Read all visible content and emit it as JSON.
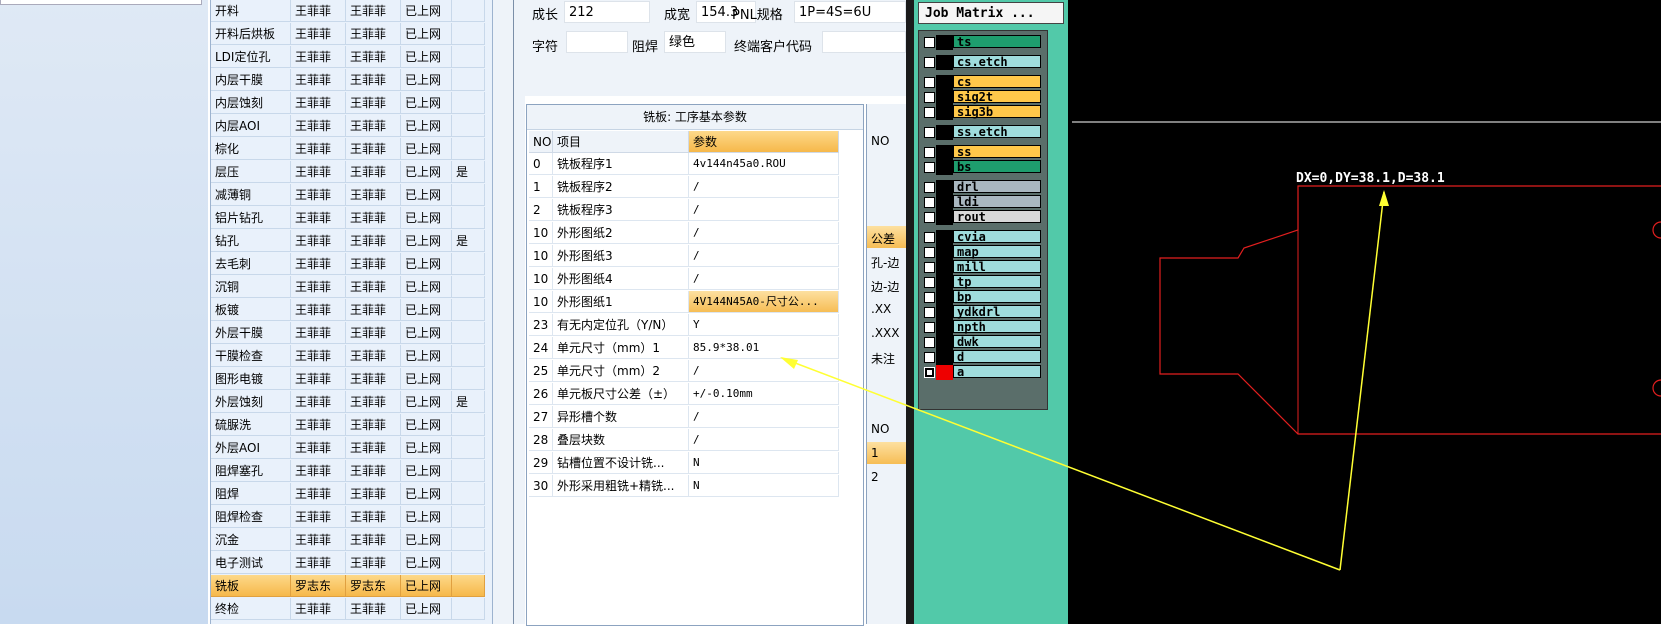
{
  "process_rows": [
    [
      "开料",
      "王菲菲",
      "王菲菲",
      "已上网",
      ""
    ],
    [
      "开料后烘板",
      "王菲菲",
      "王菲菲",
      "已上网",
      ""
    ],
    [
      "LDI定位孔",
      "王菲菲",
      "王菲菲",
      "已上网",
      ""
    ],
    [
      "内层干膜",
      "王菲菲",
      "王菲菲",
      "已上网",
      ""
    ],
    [
      "内层蚀刻",
      "王菲菲",
      "王菲菲",
      "已上网",
      ""
    ],
    [
      "内层AOI",
      "王菲菲",
      "王菲菲",
      "已上网",
      ""
    ],
    [
      "棕化",
      "王菲菲",
      "王菲菲",
      "已上网",
      ""
    ],
    [
      "层压",
      "王菲菲",
      "王菲菲",
      "已上网",
      "是"
    ],
    [
      "减薄铜",
      "王菲菲",
      "王菲菲",
      "已上网",
      ""
    ],
    [
      "铝片钻孔",
      "王菲菲",
      "王菲菲",
      "已上网",
      ""
    ],
    [
      "钻孔",
      "王菲菲",
      "王菲菲",
      "已上网",
      "是"
    ],
    [
      "去毛刺",
      "王菲菲",
      "王菲菲",
      "已上网",
      ""
    ],
    [
      "沉铜",
      "王菲菲",
      "王菲菲",
      "已上网",
      ""
    ],
    [
      "板镀",
      "王菲菲",
      "王菲菲",
      "已上网",
      ""
    ],
    [
      "外层干膜",
      "王菲菲",
      "王菲菲",
      "已上网",
      ""
    ],
    [
      "干膜检查",
      "王菲菲",
      "王菲菲",
      "已上网",
      ""
    ],
    [
      "图形电镀",
      "王菲菲",
      "王菲菲",
      "已上网",
      ""
    ],
    [
      "外层蚀刻",
      "王菲菲",
      "王菲菲",
      "已上网",
      "是"
    ],
    [
      "硫脲洗",
      "王菲菲",
      "王菲菲",
      "已上网",
      ""
    ],
    [
      "外层AOI",
      "王菲菲",
      "王菲菲",
      "已上网",
      ""
    ],
    [
      "阻焊塞孔",
      "王菲菲",
      "王菲菲",
      "已上网",
      ""
    ],
    [
      "阻焊",
      "王菲菲",
      "王菲菲",
      "已上网",
      ""
    ],
    [
      "阻焊检查",
      "王菲菲",
      "王菲菲",
      "已上网",
      ""
    ],
    [
      "沉金",
      "王菲菲",
      "王菲菲",
      "已上网",
      ""
    ],
    [
      "电子测试",
      "王菲菲",
      "王菲菲",
      "已上网",
      ""
    ],
    [
      "铣板",
      "罗志东",
      "罗志东",
      "已上网",
      ""
    ],
    [
      "终检",
      "王菲菲",
      "王菲菲",
      "已上网",
      ""
    ]
  ],
  "form": {
    "len_label": "成长",
    "len_value": "212",
    "width_label": "成宽",
    "width_value": "154.3",
    "pnl_label": "PNL规格",
    "pnl_value": "1P=4S=6U",
    "char_label": "字符",
    "char_value": "",
    "mask_label": "阻焊",
    "mask_value": "绿色",
    "cust_label": "终端客户代码",
    "cust_value": ""
  },
  "params": {
    "title": "铣板: 工序基本参数",
    "col_no": "NO",
    "col_item": "项目",
    "col_param": "参数",
    "rows": [
      [
        "0",
        "铣板程序1",
        "4v144n45a0.ROU"
      ],
      [
        "1",
        "铣板程序2",
        "/"
      ],
      [
        "2",
        "铣板程序3",
        "/"
      ],
      [
        "10",
        "外形图纸2",
        "/"
      ],
      [
        "10",
        "外形图纸3",
        "/"
      ],
      [
        "10",
        "外形图纸4",
        "/"
      ],
      [
        "10",
        "外形图纸1",
        "4V144N45A0-尺寸公..."
      ],
      [
        "23",
        "有无内定位孔（Y/N）",
        "Y"
      ],
      [
        "24",
        "单元尺寸（mm）1",
        "85.9*38.01"
      ],
      [
        "25",
        "单元尺寸（mm）2",
        "/"
      ],
      [
        "26",
        "单元板尺寸公差（±）",
        "+/-0.10mm"
      ],
      [
        "27",
        "异形槽个数",
        "/"
      ],
      [
        "28",
        "叠层块数",
        "/"
      ],
      [
        "29",
        "钻槽位置不设计铣...",
        "N"
      ],
      [
        "30",
        "外形采用粗铣+精铣...",
        "N"
      ]
    ]
  },
  "side": {
    "no1": "NO",
    "gc": "公差",
    "kong": "孔-边",
    "bian": "边-边",
    "xx": ".XX",
    "xxx": ".XXX",
    "wz": "未注",
    "no2": "NO",
    "r1": "1",
    "r2": "2"
  },
  "matrix": {
    "title": "Job Matrix ...",
    "layers": [
      {
        "name": "ts",
        "color": "#1e9e6e",
        "icon": "checkbox-icon"
      },
      {
        "name": "cs.etch",
        "color": "#9fdcdc",
        "icon": "checkbox-icon"
      },
      {
        "name": "cs",
        "color": "#ffc84a",
        "icon": "checkbox-icon"
      },
      {
        "name": "sig2t",
        "color": "#ffc84a",
        "icon": "checkbox-icon"
      },
      {
        "name": "sig3b",
        "color": "#ffc84a",
        "icon": "checkbox-icon"
      },
      {
        "name": "ss.etch",
        "color": "#9fdcdc",
        "icon": "checkbox-icon"
      },
      {
        "name": "ss",
        "color": "#ffc84a",
        "icon": "checkbox-icon"
      },
      {
        "name": "bs",
        "color": "#1e9e6e",
        "icon": "checkbox-icon"
      },
      {
        "name": "drl",
        "color": "#a9b7c0",
        "icon": "checkbox-icon"
      },
      {
        "name": "ldi",
        "color": "#a9b7c0",
        "icon": "checkbox-icon"
      },
      {
        "name": "rout",
        "color": "#d8d8d8",
        "icon": "checkbox-icon"
      },
      {
        "name": "cvia",
        "color": "#9fdcdc",
        "icon": "checkbox-icon"
      },
      {
        "name": "map",
        "color": "#9fdcdc",
        "icon": "checkbox-icon"
      },
      {
        "name": "mill",
        "color": "#9fdcdc",
        "icon": "checkbox-icon"
      },
      {
        "name": "tp",
        "color": "#9fdcdc",
        "icon": "checkbox-icon"
      },
      {
        "name": "bp",
        "color": "#9fdcdc",
        "icon": "checkbox-icon"
      },
      {
        "name": "ydkdrl",
        "color": "#9fdcdc",
        "icon": "checkbox-icon"
      },
      {
        "name": "npth",
        "color": "#9fdcdc",
        "icon": "checkbox-icon"
      },
      {
        "name": "dwk",
        "color": "#9fdcdc",
        "icon": "checkbox-icon"
      },
      {
        "name": "d",
        "color": "#9fdcdc",
        "icon": "checkbox-icon"
      },
      {
        "name": "a",
        "color": "#9fdcdc",
        "icon": "checkbox-icon"
      }
    ]
  },
  "canvas": {
    "measure": "DX=0,DY=38.1,D=38.1",
    "colors": {
      "outline": "#e21f1f",
      "arrow": "#ffff33",
      "line": "#ffffff"
    }
  }
}
